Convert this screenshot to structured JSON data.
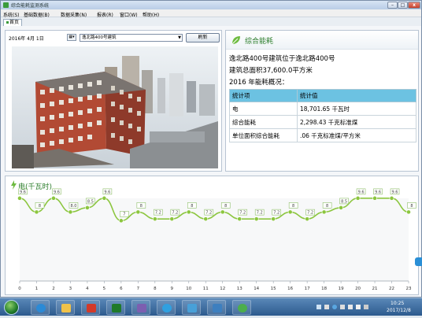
{
  "window": {
    "title": "综合能耗监测系统",
    "min_label": "–",
    "max_label": "□",
    "close_label": "x"
  },
  "menu": [
    "系统(S)",
    "基础数据(B)",
    "数据采集(N)",
    "报表(R)",
    "窗口(W)",
    "帮助(H)"
  ],
  "tab": {
    "home": "首页"
  },
  "controls": {
    "date": "2016年 4月 1日",
    "calendar_glyph": "▦▾",
    "building": "逸北路400号建筑",
    "refresh_label": "刷新"
  },
  "info_panel": {
    "title": "综合能耗",
    "line1": "逸北路400号建筑位于逸北路400号",
    "line2": "建筑总面积37,600.0平方米",
    "line3": "2016  年能耗概况：",
    "table": {
      "headers": [
        "统计项",
        "统计值"
      ],
      "rows": [
        [
          "电",
          "18,701.65 千瓦时"
        ],
        [
          "综合能耗",
          "2,298.43 千克标准煤"
        ],
        [
          "单位面积综合能耗",
          ".06 千克标准煤/平方米"
        ]
      ]
    }
  },
  "chart_data": {
    "type": "line",
    "title": "电(千瓦时)",
    "x": [
      0,
      1,
      2,
      3,
      4,
      5,
      6,
      7,
      8,
      9,
      10,
      11,
      12,
      13,
      14,
      15,
      16,
      17,
      18,
      19,
      20,
      21,
      22,
      23
    ],
    "x_tick_labels": [
      "0",
      "1",
      "2",
      "3",
      "4",
      "5",
      "6",
      "7",
      "8",
      "9",
      "10",
      "11",
      "12",
      "13",
      "14",
      "15",
      "16",
      "17",
      "18",
      "19",
      "20",
      "21",
      "22",
      "23"
    ],
    "values": [
      9.6,
      8,
      9.6,
      8.0,
      8.5,
      9.6,
      7,
      8,
      7.2,
      7.2,
      8,
      7.2,
      8,
      7.2,
      7.2,
      7.2,
      8,
      7.2,
      8,
      8.5,
      9.6,
      9.6,
      9.6,
      8
    ],
    "data_labels": [
      "9.6",
      "8",
      "9.6",
      "8.0",
      "8.5",
      "9.6",
      "7",
      "8",
      "7.2",
      "7.2",
      "8",
      "7.2",
      "8",
      "7.2",
      "7.2",
      "7.2",
      "8",
      "7.2",
      "8",
      "8.5",
      "9.6",
      "9.6",
      "9.6",
      "8"
    ],
    "ylim": [
      0,
      10.5
    ],
    "grid": false,
    "series_color": "#8cc63f"
  },
  "taskbar": {
    "time": "10:25",
    "date": "2017/12/8",
    "items": [
      "ie-icon",
      "folder-icon",
      "app-icon",
      "terminal-icon",
      "tool-icon",
      "skype-icon",
      "network-icon",
      "monitor-icon",
      "recycle-icon"
    ]
  }
}
